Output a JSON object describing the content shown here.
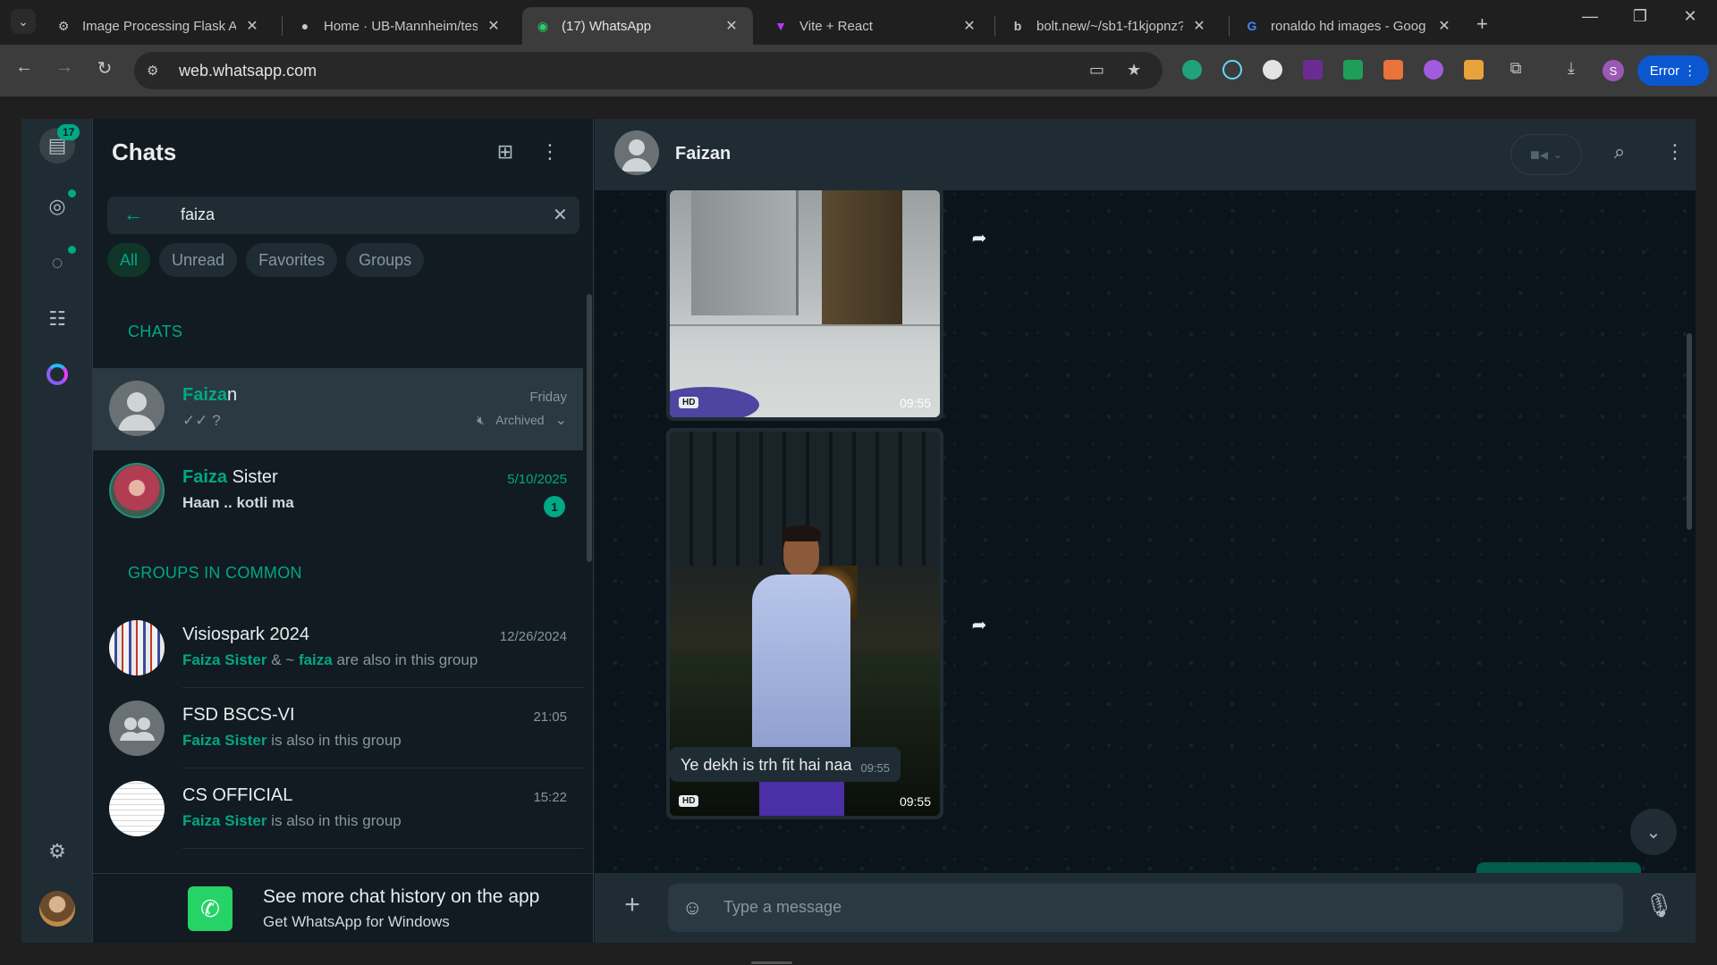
{
  "browser": {
    "tabs": [
      {
        "title": "Image Processing Flask API",
        "icon": "tool-icon"
      },
      {
        "title": "Home · UB-Mannheim/tess",
        "icon": "github-icon"
      },
      {
        "title": "(17) WhatsApp",
        "icon": "whatsapp-icon",
        "active": true
      },
      {
        "title": "Vite + React",
        "icon": "vite-icon"
      },
      {
        "title": "bolt.new/~/sb1-f1kjopnz?",
        "icon": "bolt-icon"
      },
      {
        "title": "ronaldo hd images - Goog",
        "icon": "google-icon"
      }
    ],
    "url": "web.whatsapp.com",
    "profile_initial": "S",
    "error_label": "Error"
  },
  "rail": {
    "chats_badge": "17"
  },
  "sidebar": {
    "title": "Chats",
    "search_value": "faiza",
    "filters": [
      "All",
      "Unread",
      "Favorites",
      "Groups"
    ],
    "section_chats": "CHATS",
    "section_groups": "GROUPS IN COMMON",
    "chats": [
      {
        "name_hl": "Faiza",
        "name_rest": "n",
        "time": "Friday",
        "preview": "✓✓ ?",
        "meta": "Archived"
      },
      {
        "name_hl": "Faiza",
        "name_rest": " Sister",
        "time": "5/10/2025",
        "preview": "Haan .. kotli ma",
        "unread": "1"
      }
    ],
    "groups": [
      {
        "name": "Visiospark 2024",
        "time": "12/26/2024",
        "hl1": "Faiza Sister",
        "mid": " & ~ ",
        "hl2": "faiza",
        "rest": " are also in this group"
      },
      {
        "name": "FSD BSCS-VI",
        "time": "21:05",
        "hl1": "Faiza Sister",
        "rest": " is also in this group"
      },
      {
        "name": "CS OFFICIAL",
        "time": "15:22",
        "hl1": "Faiza Sister",
        "rest": " is also in this group"
      }
    ],
    "promo_title": "See more chat history on the app",
    "promo_sub": "Get WhatsApp for Windows"
  },
  "conversation": {
    "contact": "Faizan",
    "messages": [
      {
        "type": "image",
        "badge": "HD",
        "time": "09:55"
      },
      {
        "type": "image",
        "badge": "HD",
        "time": "09:55"
      },
      {
        "type": "text",
        "text": "Ye dekh is trh fit hai naa",
        "time": "09:55"
      }
    ],
    "composer_placeholder": "Type a message"
  },
  "colors": {
    "accent": "#00a884",
    "panel": "#111b21",
    "header": "#202c33",
    "wallpaper": "#0b141a"
  }
}
